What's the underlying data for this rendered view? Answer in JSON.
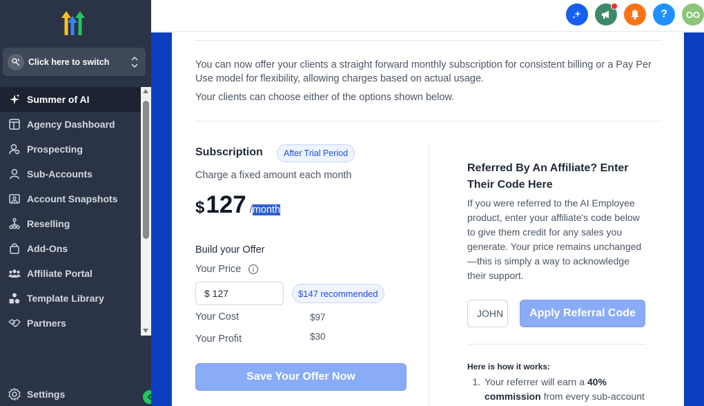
{
  "sidebar": {
    "switcher_label": "Click here to switch",
    "items": [
      {
        "label": "Summer of AI",
        "icon": "sparkle-icon",
        "active": true
      },
      {
        "label": "Agency Dashboard",
        "icon": "dashboard-icon"
      },
      {
        "label": "Prospecting",
        "icon": "user-search-icon"
      },
      {
        "label": "Sub-Accounts",
        "icon": "user-icon"
      },
      {
        "label": "Account Snapshots",
        "icon": "snapshot-icon"
      },
      {
        "label": "Reselling",
        "icon": "hierarchy-icon"
      },
      {
        "label": "Add-Ons",
        "icon": "shopping-bag-icon"
      },
      {
        "label": "Affiliate Portal",
        "icon": "users-group-icon"
      },
      {
        "label": "Template Library",
        "icon": "shapes-icon"
      },
      {
        "label": "Partners",
        "icon": "handshake-icon"
      }
    ],
    "settings_label": "Settings"
  },
  "topbar": {
    "avatar_initials": "OO",
    "icons": [
      "ai-sparkle-icon",
      "megaphone-icon",
      "bell-icon",
      "help-icon"
    ],
    "colors": {
      "ai": "#155eef",
      "megaphone": "#3d8a6b",
      "bell": "#f97316",
      "help": "#1e90ff",
      "avatar": "#8bc47a"
    }
  },
  "intro": {
    "text": "You can now offer your clients a straight forward monthly subscription for consistent billing or a Pay Per Use model for flexibility, allowing charges based on actual usage.",
    "choose_text": "Your clients can choose either of the options shown below."
  },
  "subscription": {
    "title": "Subscription",
    "badge": "After Trial Period",
    "description": "Charge a fixed amount each month",
    "currency": "$",
    "amount": "127",
    "slash": "/",
    "per": "month"
  },
  "offer": {
    "title": "Build your Offer",
    "your_price_label": "Your Price",
    "price_input_value": "$ 127",
    "recommended": "$147 recommended",
    "cost_label": "Your Cost",
    "cost_value": "$97",
    "profit_label": "Your Profit",
    "profit_value": "$30",
    "save_button": "Save Your Offer Now"
  },
  "referral": {
    "title": "Referred By An Affiliate? Enter Their Code Here",
    "description": "If you were referred to the AI Employee product, enter your affiliate's code below to give them credit for any sales you generate. Your price remains unchanged—this is simply a way to acknowledge their support.",
    "code_input_value": "JOHN",
    "apply_button": "Apply Referral Code",
    "how_title": "Here is how it works:",
    "step1_num": "1.",
    "step1_pre": "Your referrer will earn a ",
    "step1_bold1": "40%",
    "step1_bold2": "commission",
    "step1_post": " from every sub-account"
  },
  "colors": {
    "sidebar_bg": "#2a3446",
    "page_blue": "#0b3fbf",
    "button_blue": "#8aabf5",
    "badge_text": "#1d4ed8"
  }
}
